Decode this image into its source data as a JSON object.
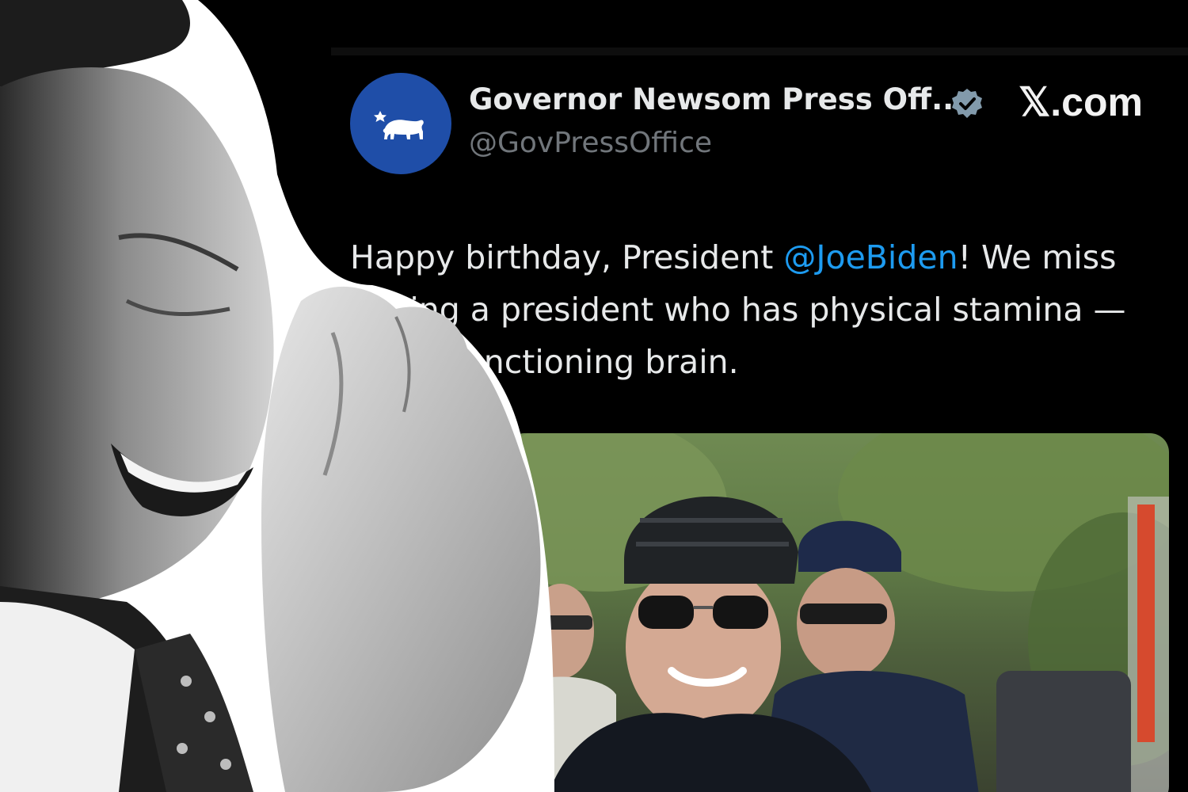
{
  "site": {
    "label": "𝕏.com"
  },
  "tweet": {
    "author": {
      "display_name": "Governor Newsom Press Off...",
      "handle": "@GovPressOffice",
      "verified": true,
      "avatar_icon": "california-bear-flag-icon",
      "avatar_color": "#1f4ea8"
    },
    "text_lines": [
      {
        "before": "Happy birthday, President ",
        "mention": "@JoeBiden",
        "after": "! We miss"
      },
      {
        "text": "having a president who has physical stamina —"
      },
      {
        "text": "and a functioning brain."
      }
    ],
    "media": {
      "icon": "photo-cyclists-helmets-sunglasses"
    }
  },
  "overlay": {
    "icon": "photo-laughing-man-grayscale"
  },
  "colors": {
    "background": "#000000",
    "text": "#e7e9ea",
    "handle": "#71767b",
    "mention": "#1d9bf0",
    "verified": "#829aab"
  }
}
